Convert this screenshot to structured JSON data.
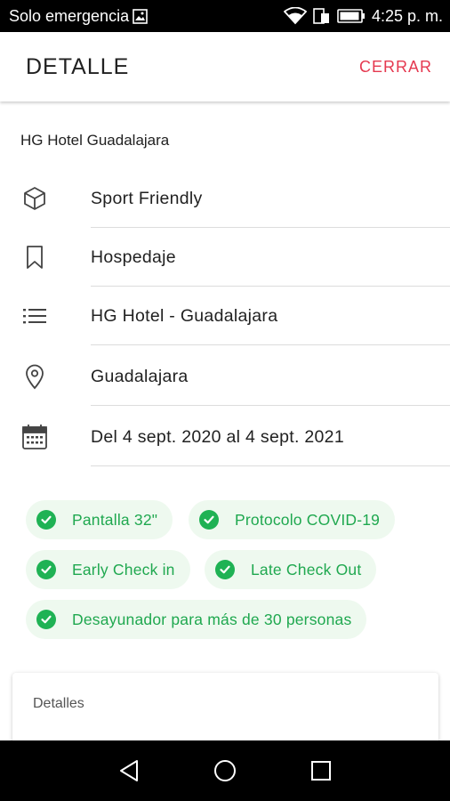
{
  "status_bar": {
    "carrier": "Solo emergencia",
    "time": "4:25 p. m.",
    "icons": [
      "image-icon",
      "wifi-icon",
      "sim-icon",
      "battery-icon"
    ]
  },
  "app_bar": {
    "title": "DETALLE",
    "close_label": "CERRAR"
  },
  "detail": {
    "hotel_name": "HG Hotel Guadalajara",
    "rows": [
      {
        "icon": "cube-icon",
        "label": "Sport Friendly"
      },
      {
        "icon": "bookmark-icon",
        "label": "Hospedaje"
      },
      {
        "icon": "list-icon",
        "label": "HG Hotel - Guadalajara"
      },
      {
        "icon": "location-pin-icon",
        "label": "Guadalajara"
      },
      {
        "icon": "calendar-icon",
        "label": "Del 4 sept. 2020 al 4 sept. 2021"
      }
    ]
  },
  "amenities": [
    {
      "label": "Pantalla 32\""
    },
    {
      "label": "Protocolo COVID-19"
    },
    {
      "label": "Early Check in"
    },
    {
      "label": "Late Check Out"
    },
    {
      "label": "Desayunador para más de 30 personas"
    }
  ],
  "details_card": {
    "title": "Detalles"
  },
  "colors": {
    "accent": "#e53950",
    "amenity_text": "#1fa84f",
    "amenity_bg": "#eef9ef",
    "check": "#1fb254"
  },
  "nav_bar": {
    "buttons": [
      "back-icon",
      "home-icon",
      "recents-icon"
    ]
  }
}
